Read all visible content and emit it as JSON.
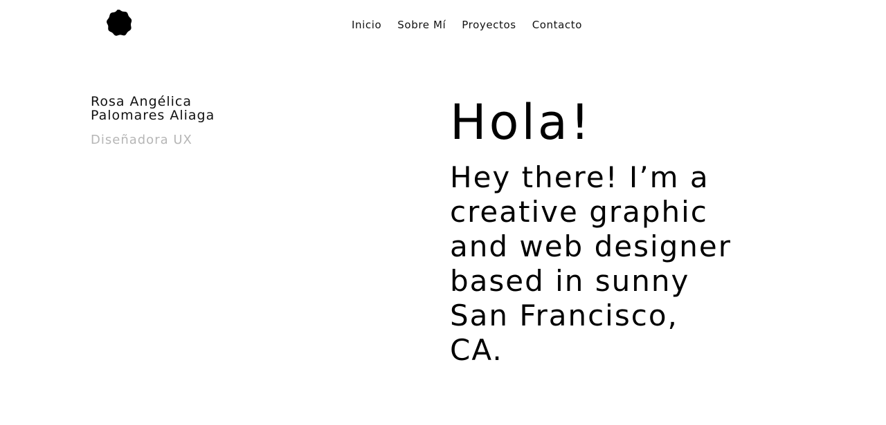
{
  "header": {
    "logo_icon": "scalloped-circle-logo-icon",
    "nav": [
      {
        "label": "Inicio"
      },
      {
        "label": "Sobre Mí"
      },
      {
        "label": "Proyectos"
      },
      {
        "label": "Contacto"
      }
    ]
  },
  "profile": {
    "name_line1": "Rosa Angélica",
    "name_line2": "Palomares Aliaga",
    "role": "Diseñadora UX"
  },
  "hero": {
    "title": "Hola!",
    "lines": [
      "Hey there! I’m a",
      "creative graphic",
      "and web designer",
      "based in sunny",
      "San Francisco,",
      "CA."
    ]
  },
  "colors": {
    "text": "#000000",
    "muted": "#b6b6b6",
    "background": "#ffffff"
  }
}
